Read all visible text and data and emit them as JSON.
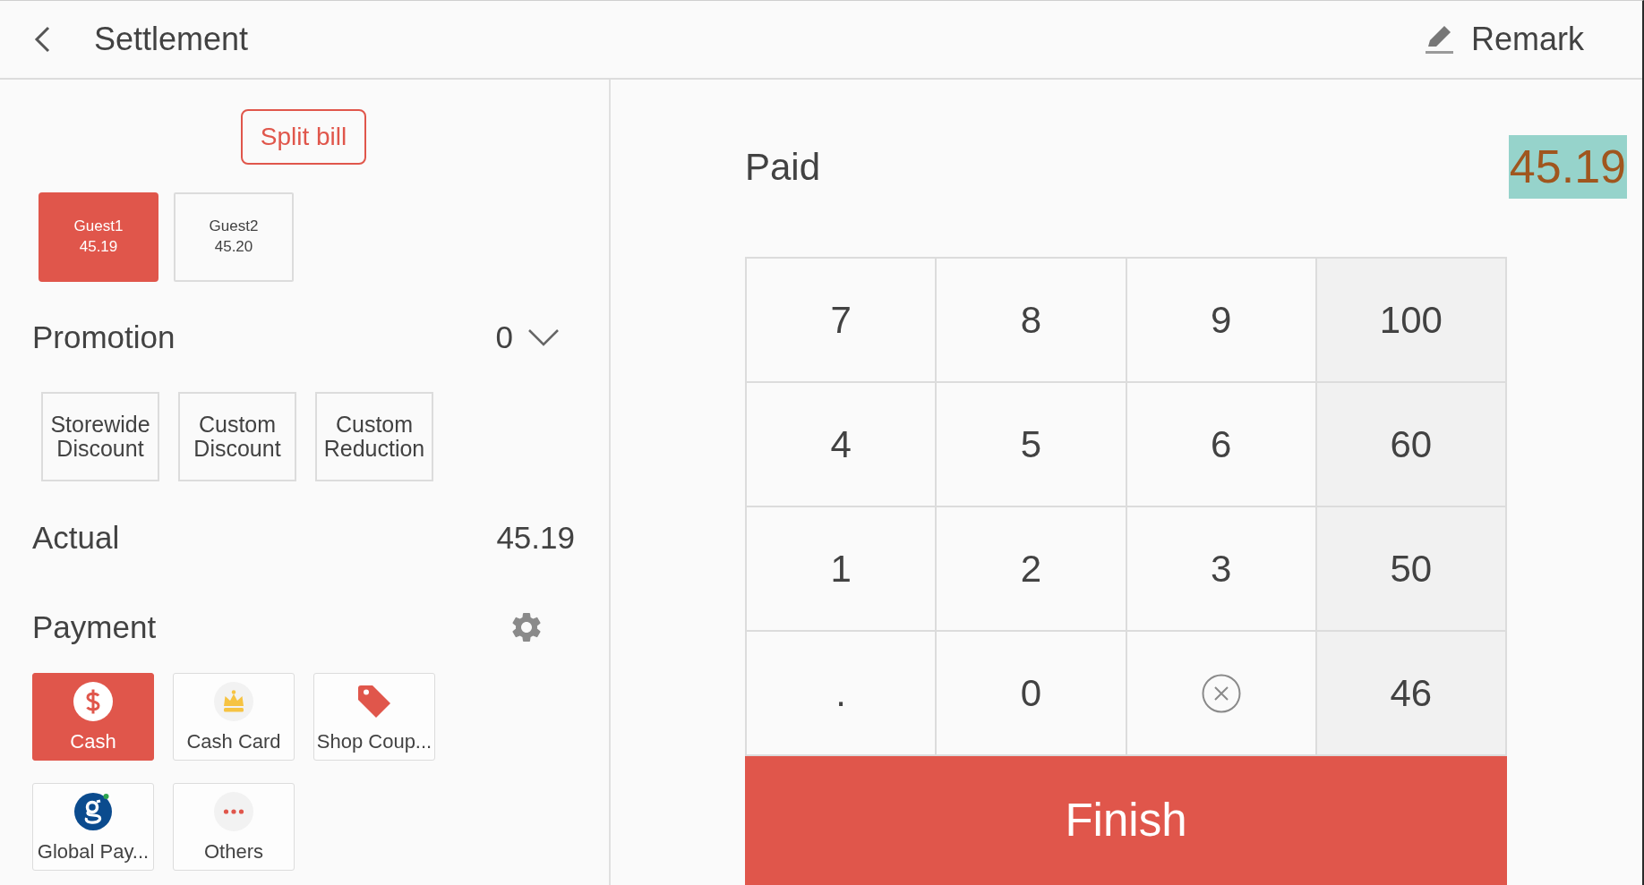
{
  "header": {
    "title": "Settlement",
    "action": "Remark"
  },
  "split_bill": {
    "label": "Split bill"
  },
  "guests": [
    {
      "name": "Guest1",
      "amount": "45.19",
      "selected": true
    },
    {
      "name": "Guest2",
      "amount": "45.20",
      "selected": false
    }
  ],
  "promotion": {
    "label": "Promotion",
    "count": "0",
    "options": [
      "Storewide Discount",
      "Custom Discount",
      "Custom Reduction"
    ]
  },
  "actual": {
    "label": "Actual",
    "amount": "45.19"
  },
  "payment": {
    "label": "Payment",
    "methods": [
      {
        "kind": "cash",
        "label": "Cash",
        "selected": true
      },
      {
        "kind": "card",
        "label": "Cash Card",
        "selected": false
      },
      {
        "kind": "coupon",
        "label": "Shop Coup...",
        "selected": false
      },
      {
        "kind": "global",
        "label": "Global Pay...",
        "selected": false
      },
      {
        "kind": "others",
        "label": "Others",
        "selected": false
      }
    ]
  },
  "paid": {
    "label": "Paid",
    "amount": "45.19",
    "highlighted": true
  },
  "keypad": [
    {
      "kind": "digit",
      "label": "7"
    },
    {
      "kind": "digit",
      "label": "8"
    },
    {
      "kind": "digit",
      "label": "9"
    },
    {
      "kind": "preset",
      "label": "100"
    },
    {
      "kind": "digit",
      "label": "4"
    },
    {
      "kind": "digit",
      "label": "5"
    },
    {
      "kind": "digit",
      "label": "6"
    },
    {
      "kind": "preset",
      "label": "60"
    },
    {
      "kind": "digit",
      "label": "1"
    },
    {
      "kind": "digit",
      "label": "2"
    },
    {
      "kind": "digit",
      "label": "3"
    },
    {
      "kind": "preset",
      "label": "50"
    },
    {
      "kind": "digit",
      "label": "."
    },
    {
      "kind": "digit",
      "label": "0"
    },
    {
      "kind": "clear"
    },
    {
      "kind": "preset",
      "label": "46"
    }
  ],
  "finish": {
    "label": "Finish"
  }
}
